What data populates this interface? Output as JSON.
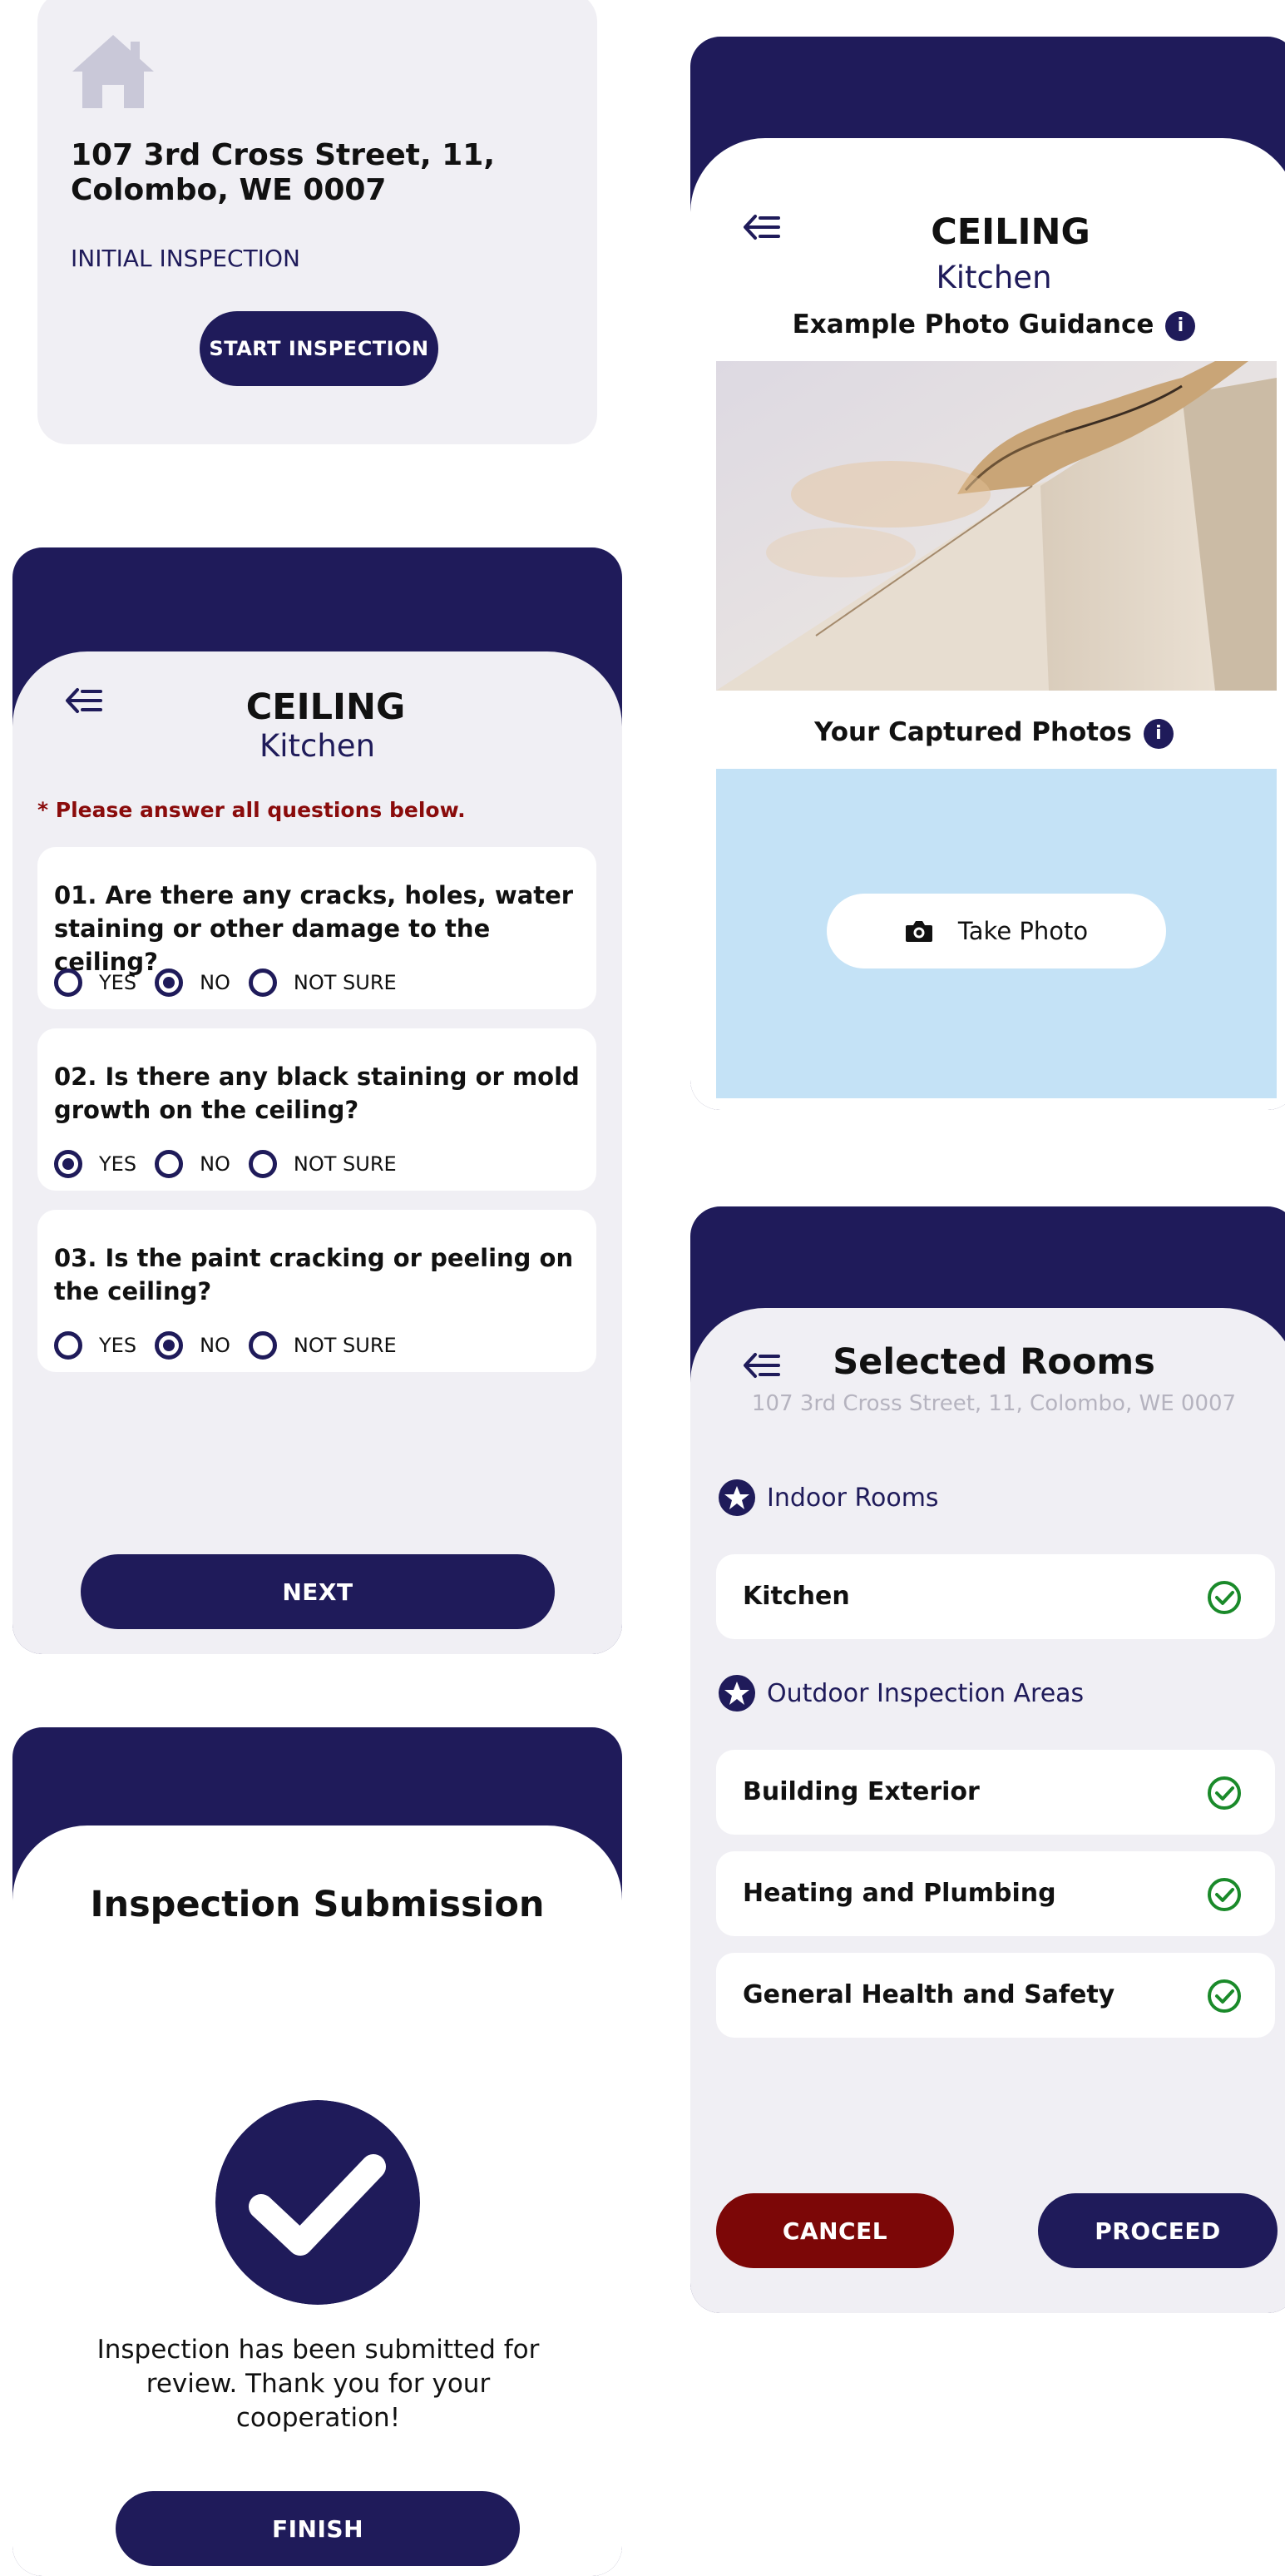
{
  "colors": {
    "navy": "#1f1b5a",
    "warning_red": "#8a0b0b",
    "cancel_red": "#7c0707",
    "panel_gray": "#f0eff4",
    "photo_area": "#c4e2f6",
    "check_green": "#1a8a2a"
  },
  "home_card": {
    "icon": "house-icon",
    "address": "107 3rd Cross Street, 11, Colombo, WE 0007",
    "inspection_type": "INITIAL INSPECTION",
    "start_button": "START INSPECTION"
  },
  "questions_screen": {
    "title": "CEILING",
    "subtitle": "Kitchen",
    "warning": "* Please answer all questions below.",
    "questions": [
      {
        "text": "01. Are there any cracks, holes, water staining or other damage to the ceiling?",
        "selected": "NO"
      },
      {
        "text": "02. Is there any black staining or mold growth on the ceiling?",
        "selected": "YES"
      },
      {
        "text": "03. Is the paint cracking or peeling on the ceiling?",
        "selected": "NO"
      }
    ],
    "options": [
      "YES",
      "NO",
      "NOT SURE"
    ],
    "next_button": "NEXT"
  },
  "submission_screen": {
    "title": "Inspection Submission",
    "message": "Inspection has been submitted for review. Thank you for your cooperation!",
    "finish_button": "FINISH"
  },
  "photo_screen": {
    "title": "CEILING",
    "subtitle": "Kitchen",
    "example_heading": "Example Photo Guidance",
    "captured_heading": "Your Captured Photos",
    "info_glyph": "i",
    "take_photo_button": "Take Photo"
  },
  "rooms_screen": {
    "title": "Selected Rooms",
    "address": "107 3rd Cross Street, 11, Colombo, WE 0007",
    "indoor_heading": "Indoor Rooms",
    "indoor_rooms": [
      "Kitchen"
    ],
    "outdoor_heading": "Outdoor Inspection Areas",
    "outdoor_areas": [
      "Building Exterior",
      "Heating and Plumbing",
      "General Health and Safety"
    ],
    "cancel_button": "CANCEL",
    "proceed_button": "PROCEED"
  }
}
